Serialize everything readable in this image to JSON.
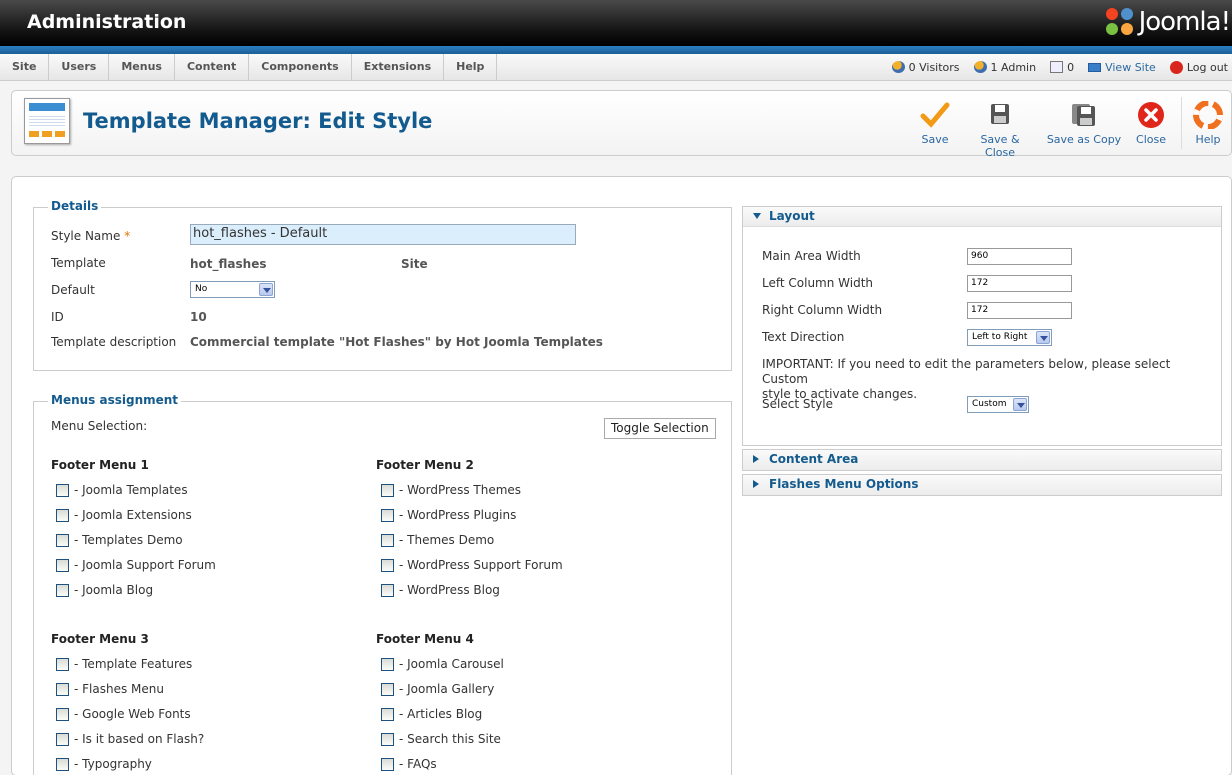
{
  "header": {
    "title": "Administration",
    "logo_text": "Joomla!"
  },
  "menu": {
    "items": [
      "Site",
      "Users",
      "Menus",
      "Content",
      "Components",
      "Extensions",
      "Help"
    ]
  },
  "status": {
    "visitors": "0 Visitors",
    "admins": "1 Admin",
    "messages": "0",
    "view_site": "View Site",
    "logout": "Log out"
  },
  "toolbar": {
    "title": "Template Manager: Edit Style",
    "save": "Save",
    "save_close": "Save & Close",
    "save_copy": "Save as Copy",
    "close": "Close",
    "help": "Help"
  },
  "details": {
    "legend": "Details",
    "style_name_label": "Style Name",
    "required_mark": "*",
    "style_name_value": "hot_flashes - Default",
    "template_label": "Template",
    "template_value": "hot_flashes",
    "template_client": "Site",
    "default_label": "Default",
    "default_value": "No",
    "id_label": "ID",
    "id_value": "10",
    "desc_label": "Template description",
    "desc_value": "Commercial template \"Hot Flashes\" by Hot Joomla Templates"
  },
  "menus": {
    "legend": "Menus assignment",
    "selection_label": "Menu Selection:",
    "toggle_label": "Toggle Selection",
    "groups": [
      {
        "title": "Footer Menu 1",
        "items": [
          "- Joomla Templates",
          "- Joomla Extensions",
          "- Templates Demo",
          "- Joomla Support Forum",
          "- Joomla Blog"
        ]
      },
      {
        "title": "Footer Menu 2",
        "items": [
          "- WordPress Themes",
          "- WordPress Plugins",
          "- Themes Demo",
          "- WordPress Support Forum",
          "- WordPress Blog"
        ]
      },
      {
        "title": "Footer Menu 3",
        "items": [
          "- Template Features",
          "- Flashes Menu",
          "- Google Web Fonts",
          "- Is it based on Flash?",
          "- Typography"
        ]
      },
      {
        "title": "Footer Menu 4",
        "items": [
          "- Joomla Carousel",
          "- Joomla Gallery",
          "- Articles Blog",
          "- Search this Site",
          "- FAQs"
        ]
      }
    ]
  },
  "layout": {
    "title": "Layout",
    "main_width_label": "Main Area Width",
    "main_width_value": "960",
    "left_width_label": "Left Column Width",
    "left_width_value": "172",
    "right_width_label": "Right Column Width",
    "right_width_value": "172",
    "text_dir_label": "Text Direction",
    "text_dir_value": "Left to Right",
    "important_line1": "IMPORTANT: If you need to edit the parameters below, please select Custom",
    "important_line2": "style to activate changes.",
    "select_style_label": "Select Style",
    "select_style_value": "Custom"
  },
  "accordion": {
    "content_area": "Content Area",
    "flashes_menu": "Flashes Menu Options"
  }
}
